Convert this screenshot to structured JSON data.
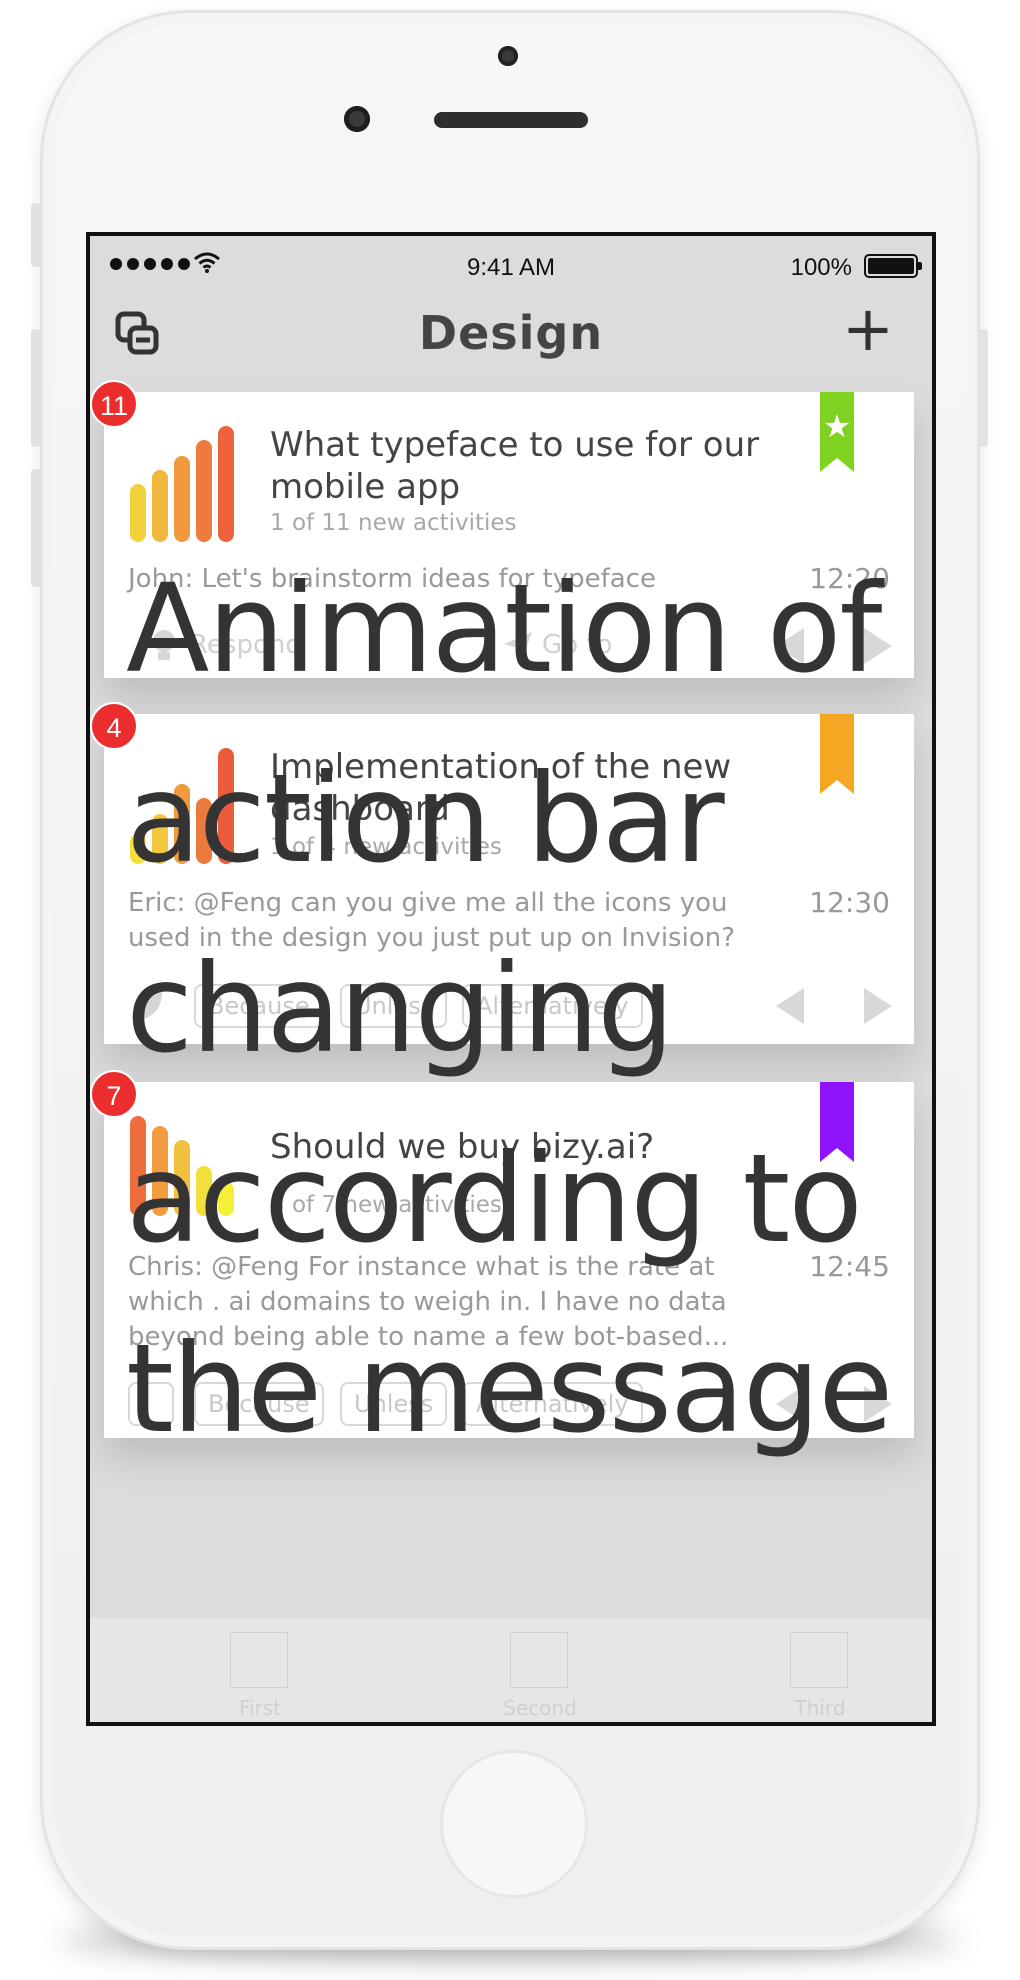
{
  "status_bar": {
    "time": "9:41 AM",
    "battery": "100%"
  },
  "nav": {
    "title": "Design",
    "add_label": "+",
    "left_icon": "share-icon"
  },
  "cards": [
    {
      "badge": "11",
      "ribbon_color": "#7ed321",
      "ribbon_icon": "star-icon",
      "title": "What typeface to use for our mobile app",
      "subtitle": "1 of 11 new activities",
      "message": "John: Let's brainstorm ideas for typeface",
      "time": "12:20",
      "actions": {
        "respond": "Respond",
        "goto": "Go to"
      },
      "bar_colors": [
        "#f1d13c",
        "#f1b83f",
        "#f0993e",
        "#ee7b3d",
        "#ec633c"
      ]
    },
    {
      "badge": "4",
      "ribbon_color": "#f5a623",
      "title": "Implementation of the new dashboard",
      "subtitle": "1 of 4 new activities",
      "message": "Eric: @Feng can you give me all the icons you used in the design you just put up on Invision?",
      "time": "12:30",
      "chips": [
        "Because",
        "Unless",
        "Alternatively"
      ],
      "bar_colors": [
        "#f3e03a",
        "#f2c83c",
        "#ef9a3c",
        "#ed7a3d",
        "#ea5c3b"
      ]
    },
    {
      "badge": "7",
      "ribbon_color": "#9013fe",
      "title": "Should we buy bizy.ai?",
      "subtitle": "3 of 7 new activities",
      "message": "Chris: @Feng For instance what is the rate at which . ai domains to weigh in. I have no data beyond being able to name a few bot-based...",
      "time": "12:45",
      "chips": [
        "Because",
        "Unless",
        "Alternatively"
      ],
      "bar_colors": [
        "#ee6d3c",
        "#f29b3f",
        "#f2c03f",
        "#f3df3c",
        "#f4f03a"
      ]
    }
  ],
  "tabs": [
    "First",
    "Second",
    "Third"
  ],
  "caption": "Animation of\naction bar\nchanging\naccording to\nthe message"
}
